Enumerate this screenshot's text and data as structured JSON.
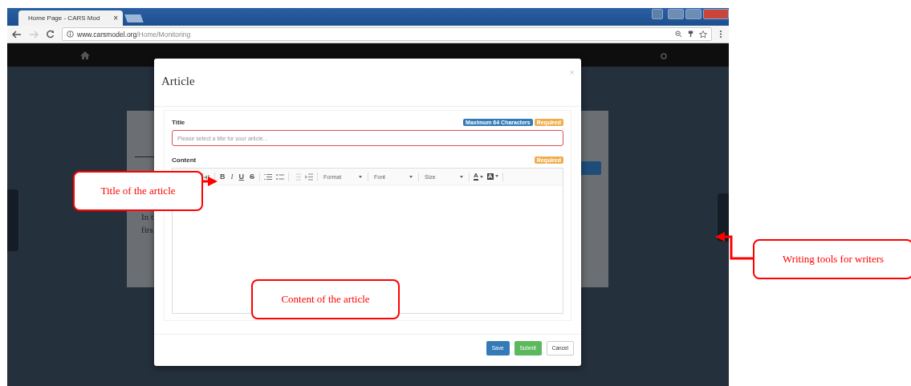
{
  "browser": {
    "tab_title": "Home Page - CARS Mod",
    "tab_close": "×",
    "url_host": "www.carsmodel.org",
    "url_path": "/Home/Monitoring"
  },
  "background_text": [
    "In t",
    "firs"
  ],
  "modal": {
    "title": "Article",
    "close": "×",
    "fields": [
      {
        "kind": "text",
        "label": "Title",
        "badges": [
          {
            "text": "Maximum 64 Characters",
            "color": "#337ab7"
          },
          {
            "text": "Required",
            "color": "#f0ad4e"
          }
        ],
        "placeholder": "Please select a title for your article..."
      },
      {
        "kind": "editor",
        "label": "Content",
        "badges": [
          {
            "text": "Required",
            "color": "#f0ad4e"
          }
        ],
        "toolbar": {
          "styles": [
            "B",
            "I",
            "U",
            "S"
          ],
          "dropdowns": [
            "Format",
            "Font",
            "Size"
          ],
          "colors": [
            "A",
            "A"
          ]
        }
      }
    ],
    "buttons": [
      {
        "label": "Save",
        "kind": "primary"
      },
      {
        "label": "Submit",
        "kind": "success"
      },
      {
        "label": "Cancel",
        "kind": "default"
      }
    ]
  },
  "callouts": [
    {
      "text": "Title of the article"
    },
    {
      "text": "Content of the article"
    },
    {
      "text": "Writing tools for writers"
    }
  ]
}
